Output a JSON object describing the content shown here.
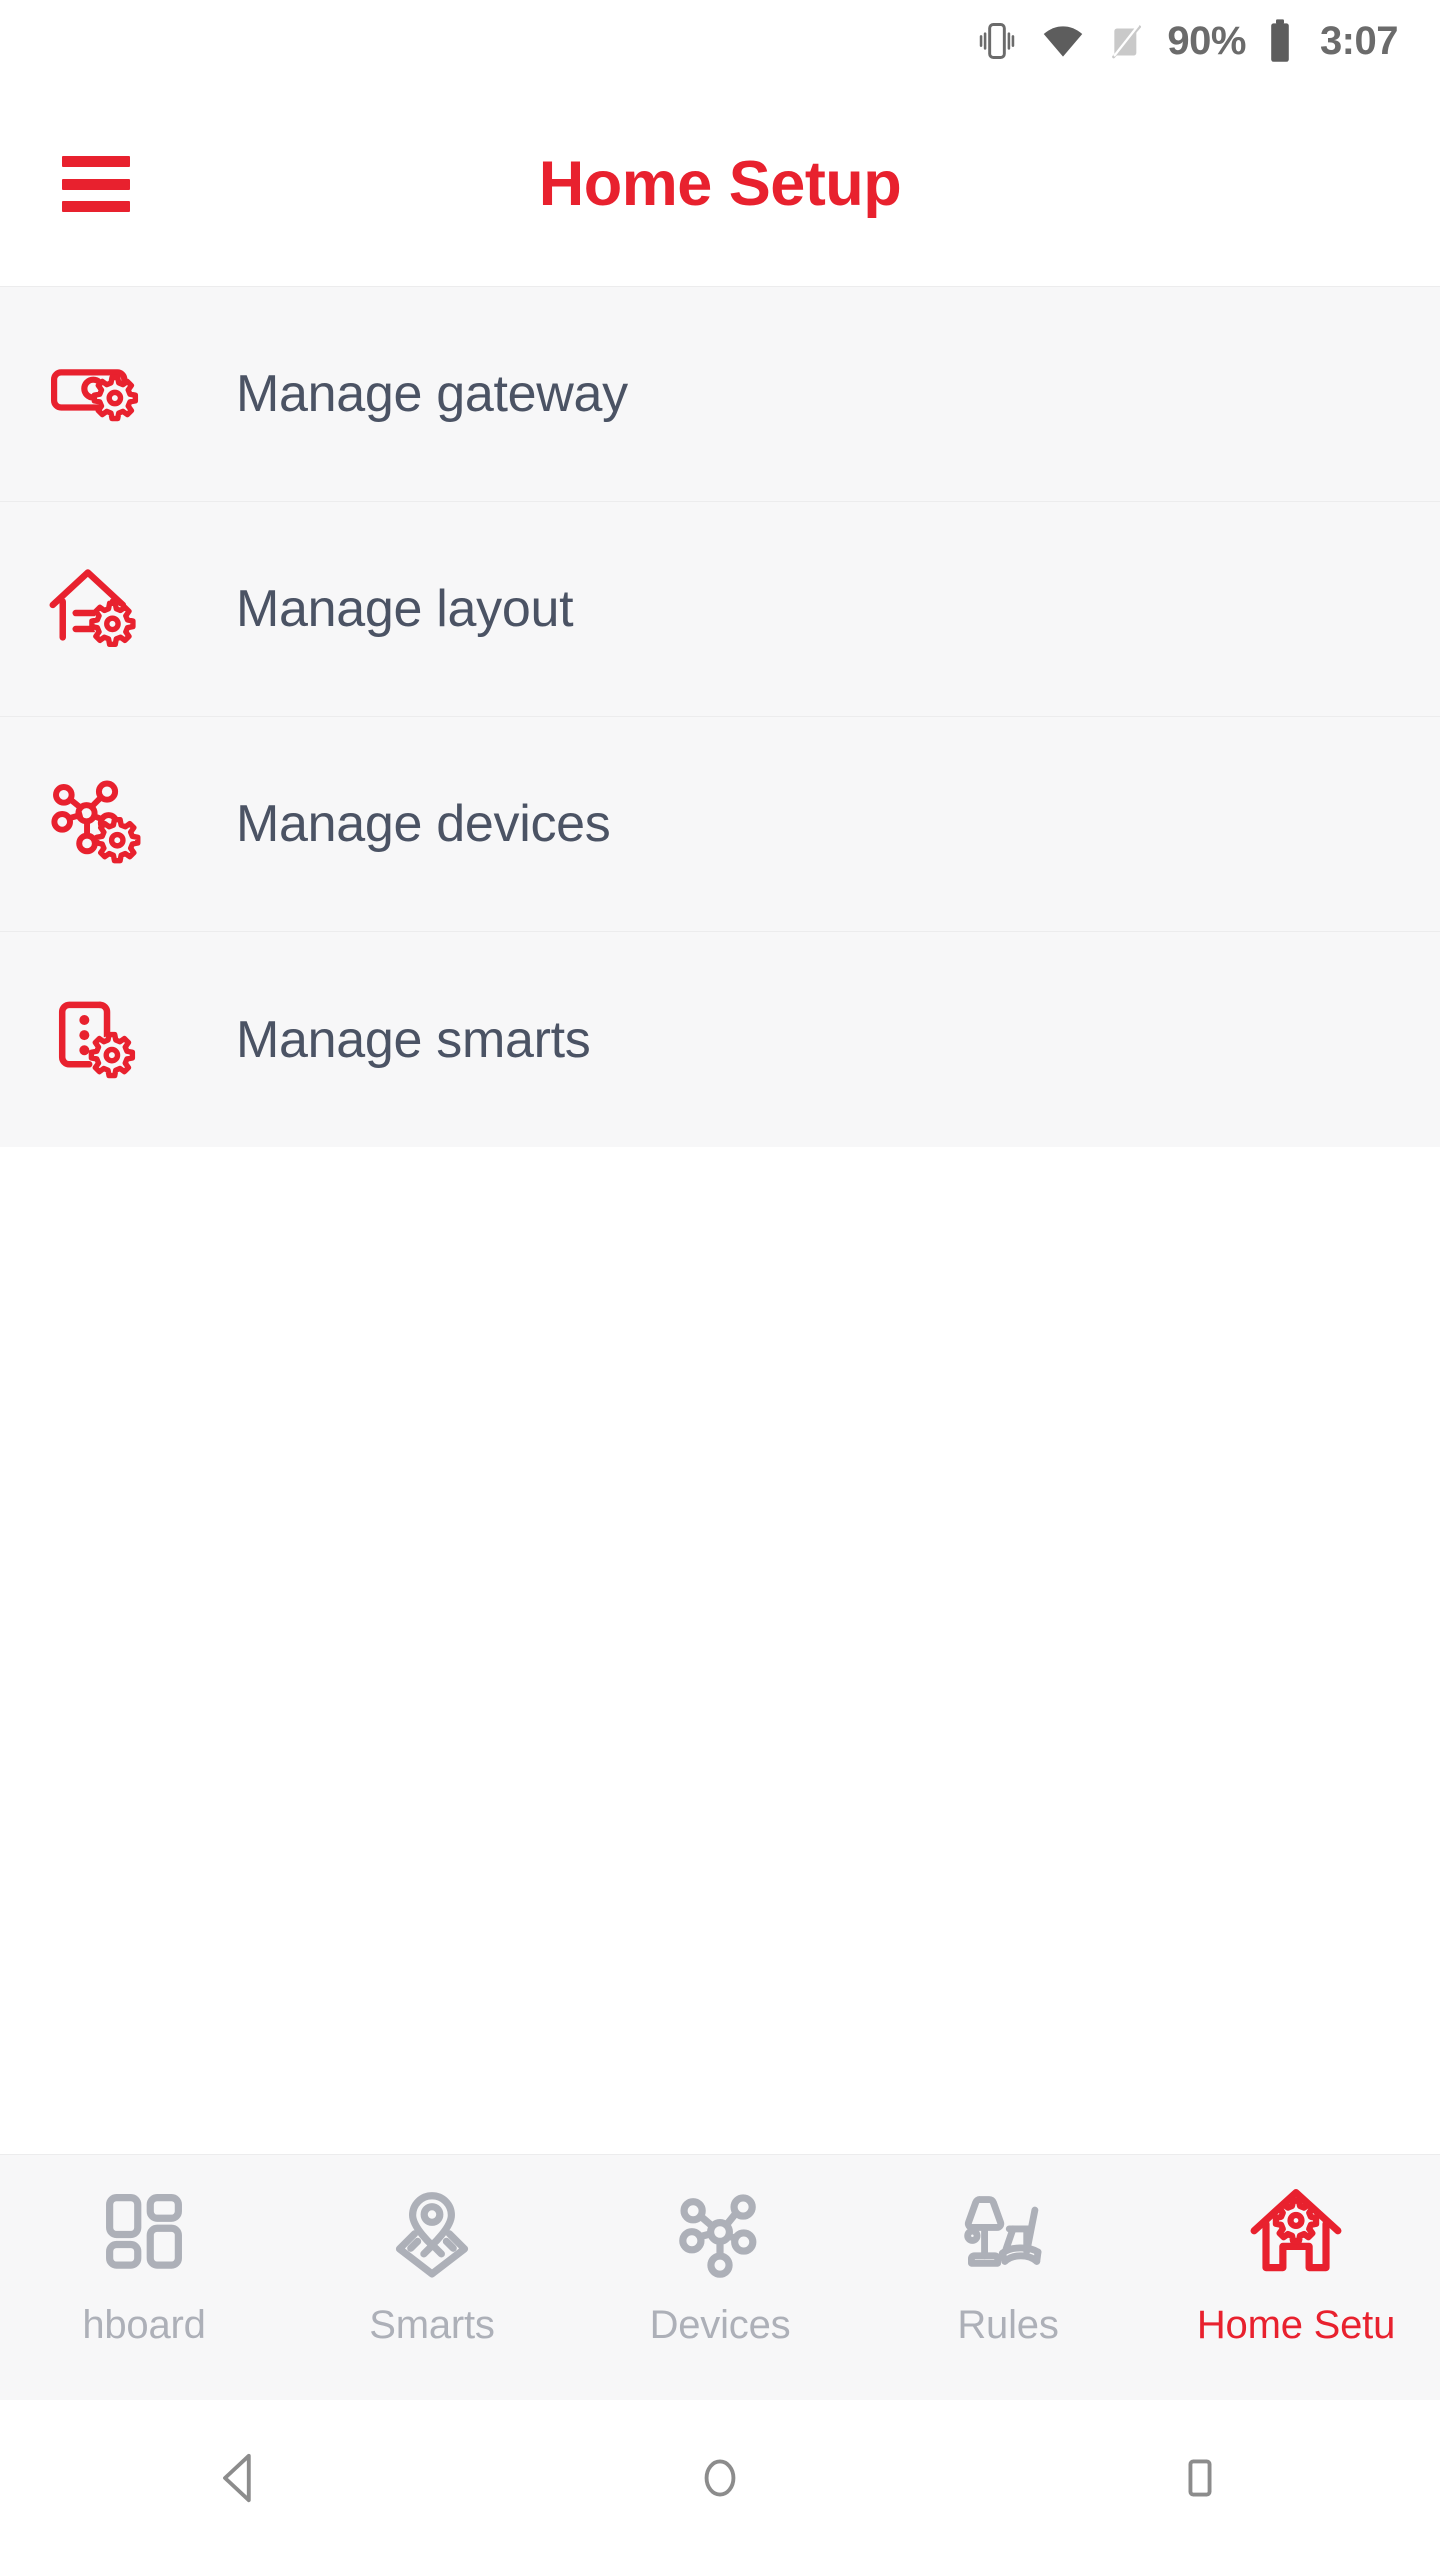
{
  "status_bar": {
    "vibrate_icon": "vibrate-icon",
    "wifi_icon": "wifi-icon",
    "signal_off_icon": "signal-off-icon",
    "battery_percent": "90%",
    "battery_icon": "battery-icon",
    "time": "3:07"
  },
  "app_bar": {
    "menu_icon": "hamburger-menu-icon",
    "title": "Home Setup"
  },
  "list": {
    "items": [
      {
        "label": "Manage gateway",
        "icon": "gateway-settings-icon"
      },
      {
        "label": "Manage layout",
        "icon": "house-layout-settings-icon"
      },
      {
        "label": "Manage devices",
        "icon": "device-network-settings-icon"
      },
      {
        "label": "Manage smarts",
        "icon": "smarts-panel-settings-icon"
      }
    ]
  },
  "bottom_nav": {
    "items": [
      {
        "label": "hboard",
        "icon": "dashboard-grid-icon",
        "active": false
      },
      {
        "label": "Smarts",
        "icon": "location-pin-icon",
        "active": false
      },
      {
        "label": "Devices",
        "icon": "device-hub-icon",
        "active": false
      },
      {
        "label": "Rules",
        "icon": "lamp-chair-icon",
        "active": false
      },
      {
        "label": "Home Setu",
        "icon": "house-gear-icon",
        "active": true
      }
    ]
  },
  "system_nav": {
    "back": "back-triangle-icon",
    "home": "home-circle-icon",
    "recents": "recents-square-icon"
  },
  "colors": {
    "accent_red": "#e8212e",
    "list_bg": "#f7f7f8",
    "text_dark": "#4b5364",
    "icon_gray": "#adb0b8",
    "status_gray": "#6b6b6b"
  }
}
